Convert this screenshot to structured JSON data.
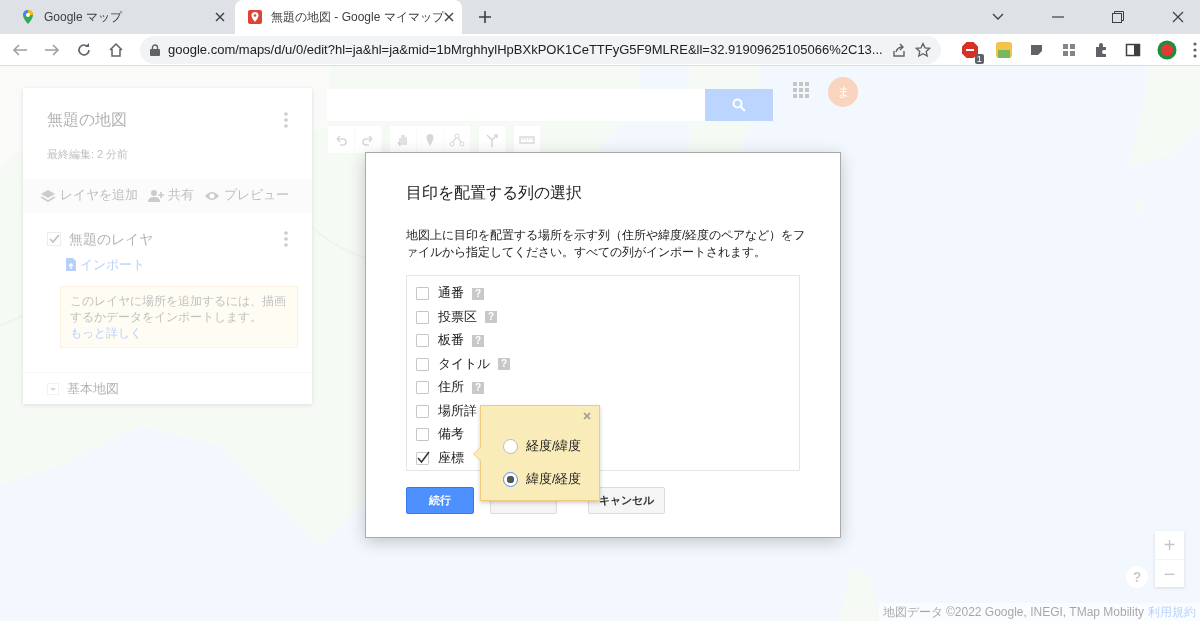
{
  "browser": {
    "tabs": [
      {
        "title": "Google マップ",
        "selected": false
      },
      {
        "title": "無題の地図 - Google マイマップ",
        "selected": true
      }
    ],
    "url": "google.com/maps/d/u/0/edit?hl=ja&hl=ja&mid=1bMrghhylHpBXkPOK1CeTTFyG5F9MLRE&ll=32.91909625105066%2C13...",
    "extension_badge": "1"
  },
  "map_panel": {
    "title": "無題の地図",
    "last_edited": "最終編集: 2 分前",
    "actions": [
      {
        "kind": "add_layer",
        "label": "レイヤを追加"
      },
      {
        "kind": "share",
        "label": "共有"
      },
      {
        "kind": "preview",
        "label": "プレビュー"
      }
    ],
    "layers": [
      {
        "name": "無題のレイヤ",
        "checked": true,
        "import_link": "インポート",
        "hint": "このレイヤに場所を追加するには、描画するかデータをインポートします。",
        "hint_link": "もっと詳しく"
      }
    ],
    "base_map": "基本地図"
  },
  "account": {
    "avatar": "ま"
  },
  "dialog": {
    "title": "目印を配置する列の選択",
    "description": "地図上に目印を配置する場所を示す列（住所や緯度/経度のペアなど）をファイルから指定してください。すべての列がインポートされます。",
    "help_mark": "?",
    "columns": [
      {
        "name": "通番",
        "checked": false,
        "help": true
      },
      {
        "name": "投票区",
        "checked": false,
        "help": true
      },
      {
        "name": "板番",
        "checked": false,
        "help": true
      },
      {
        "name": "タイトル",
        "checked": false,
        "help": true
      },
      {
        "name": "住所",
        "checked": false,
        "help": true
      },
      {
        "name": "場所詳",
        "checked": false,
        "help": false
      },
      {
        "name": "備考",
        "checked": false,
        "help": false
      },
      {
        "name": "座標",
        "checked": true,
        "help": false
      }
    ],
    "coordinate_popup": {
      "options": [
        {
          "label": "経度/緯度",
          "selected": false
        },
        {
          "label": "緯度/経度",
          "selected": true
        }
      ]
    },
    "buttons": [
      {
        "kind": "primary",
        "label": "続行"
      },
      {
        "kind": "secondary"
      },
      {
        "kind": "cancel",
        "label": "キャンセル"
      }
    ]
  },
  "map_controls": {
    "zoom_in": "+",
    "zoom_out": "−",
    "help": "?"
  },
  "attribution": {
    "text": "地図データ ©2022 Google, INEGI, TMap Mobility",
    "terms_link": "利用規約"
  }
}
